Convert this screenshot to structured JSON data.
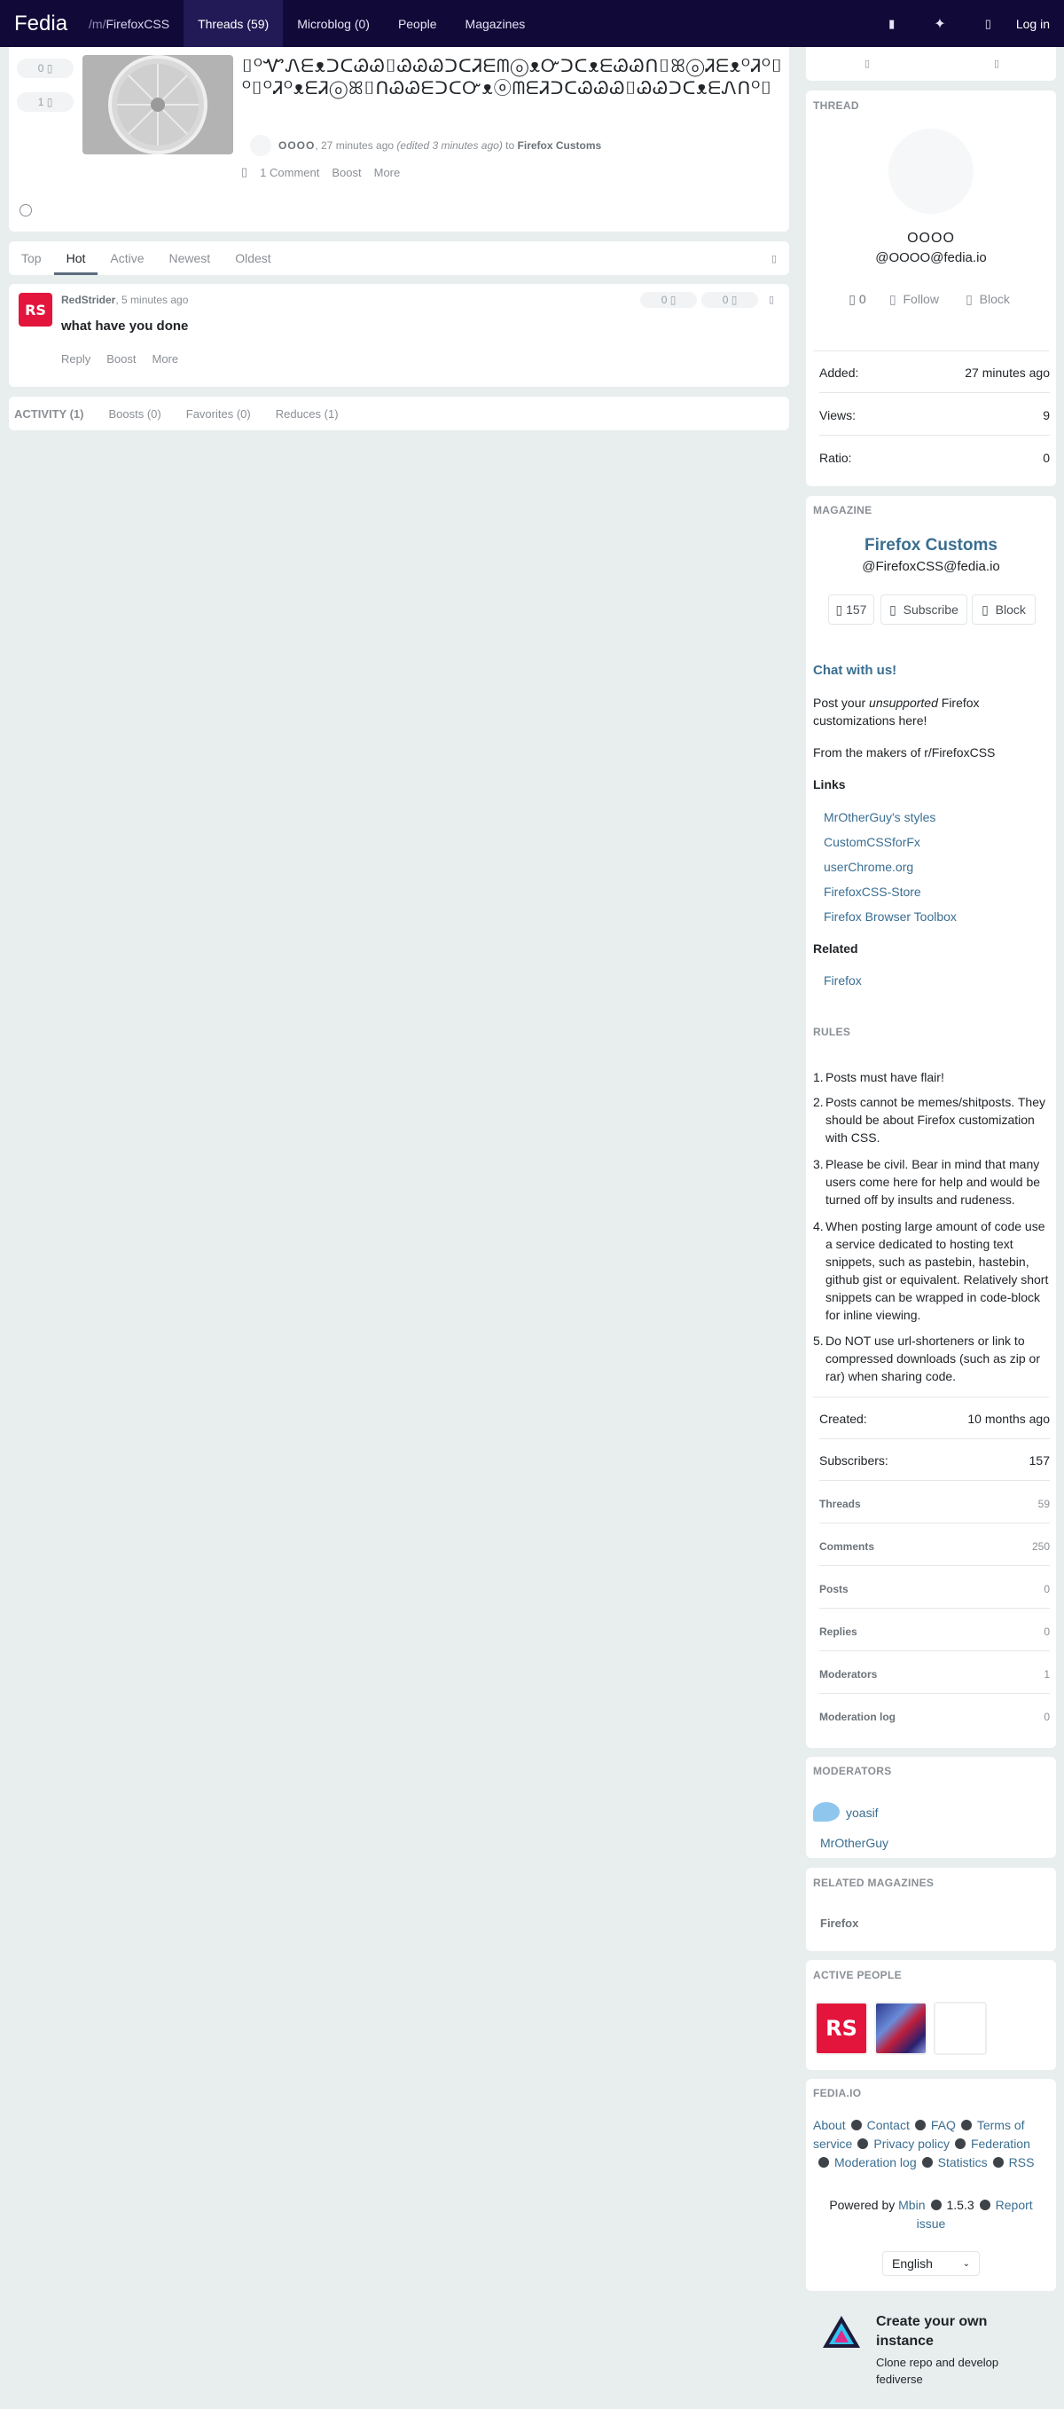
{
  "header": {
    "brand": "Fedia",
    "crumb_prefix": "/m/",
    "crumb_magazine": "FirefoxCSS",
    "nav": [
      "Threads (59)",
      "Microblog (0)",
      "People",
      "Magazines"
    ],
    "login": "Log in"
  },
  "entry": {
    "upvotes": "0",
    "downvotes": "1",
    "title": "⌷ᴼᏉᏁᗴᴥᑐᑕᏊᏊ⌷ᏊᏊᏊᑐᑕᏘᗴᗰⓞᴥᏅᑐᑕᴥᗴᏊᏊᑎ⌷ꕤⓞᏘᗴᴥᴼᏘᴼ⌷ᴼ⌷ᴼᏘᴼᴥᗴᏘⓞꕤ⌷ᑎᏊᏊᗴᑐᑕᏅᴥⓞᗰᗴᏘᑐᑕᏊᏊᏊ⌷ᏊᏊᑐᑕᴥᗴᏁᑎᴼ⌷",
    "author": "OOOO",
    "time": ", 27 minutes ago",
    "edited": "(edited 3 minutes ago)",
    "to": "to",
    "magazine": "Firefox Customs",
    "comments": "1 Comment",
    "boost": "Boost",
    "more": "More"
  },
  "sort_tabs": [
    "Top",
    "Hot",
    "Active",
    "Newest",
    "Oldest"
  ],
  "comment": {
    "avatar": "RS",
    "author": "RedStrider",
    "time": ", 5 minutes ago",
    "body": "what have you done",
    "up": "0",
    "down": "0",
    "reply": "Reply",
    "boost": "Boost",
    "more": "More"
  },
  "activity_tabs": [
    "ACTIVITY (1)",
    "Boosts (0)",
    "Favorites (0)",
    "Reduces (1)"
  ],
  "thread": {
    "section": "THREAD",
    "name": "OOOO",
    "handle": "@OOOO@fedia.io",
    "count": "0",
    "follow": "Follow",
    "block": "Block",
    "stats": [
      {
        "label": "Added:",
        "value": "27 minutes ago"
      },
      {
        "label": "Views:",
        "value": "9"
      },
      {
        "label": "Ratio:",
        "value": "0"
      }
    ]
  },
  "magazine": {
    "section": "MAGAZINE",
    "name": "Firefox Customs",
    "handle": "@FirefoxCSS@fedia.io",
    "count": "157",
    "subscribe": "Subscribe",
    "block": "Block",
    "chat": "Chat with us!",
    "post_a": "Post your ",
    "post_em": "unsupported",
    "post_b": " Firefox customizations here!",
    "makers": "From the makers of r/FirefoxCSS",
    "links_title": "Links",
    "links": [
      "MrOtherGuy's styles",
      "CustomCSSforFx",
      "userChrome.org",
      "FirefoxCSS-Store",
      "Firefox Browser Toolbox"
    ],
    "related_title": "Related",
    "related": [
      "Firefox"
    ],
    "rules_title": "RULES",
    "rules": [
      "Posts must have flair!",
      "Posts cannot be memes/shitposts. They should be about Firefox customization with CSS.",
      "Please be civil. Bear in mind that many users come here for help and would be turned off by insults and rudeness.",
      "When posting large amount of code use a service dedicated to hosting text snippets, such as pastebin, hastebin, github gist or equivalent. Relatively short snippets can be wrapped in code-block for inline viewing.",
      "Do NOT use url-shorteners or link to compressed downloads (such as zip or rar) when sharing code."
    ],
    "created_label": "Created:",
    "created": "10 months ago",
    "subscribers_label": "Subscribers:",
    "subscribers": "157",
    "small_stats": [
      {
        "label": "Threads",
        "value": "59"
      },
      {
        "label": "Comments",
        "value": "250"
      },
      {
        "label": "Posts",
        "value": "0"
      },
      {
        "label": "Replies",
        "value": "0"
      },
      {
        "label": "Moderators",
        "value": "1"
      },
      {
        "label": "Moderation log",
        "value": "0"
      }
    ]
  },
  "moderators": {
    "section": "MODERATORS",
    "list": [
      "yoasif",
      "MrOtherGuy"
    ]
  },
  "related_mags": {
    "section": "RELATED MAGAZINES",
    "list": [
      "Firefox"
    ]
  },
  "active_people": {
    "section": "ACTIVE PEOPLE",
    "avatar1": "RS"
  },
  "footer": {
    "section": "FEDIA.IO",
    "links": [
      "About",
      "Contact",
      "FAQ",
      "Terms of service",
      "Privacy policy",
      "Federation",
      "Moderation log",
      "Statistics",
      "RSS"
    ],
    "powered": "Powered by",
    "mbin": "Mbin",
    "version": "1.5.3",
    "report": "Report issue",
    "language": "English",
    "promo_title": "Create your own instance",
    "promo_sub": "Clone repo and develop fediverse"
  }
}
